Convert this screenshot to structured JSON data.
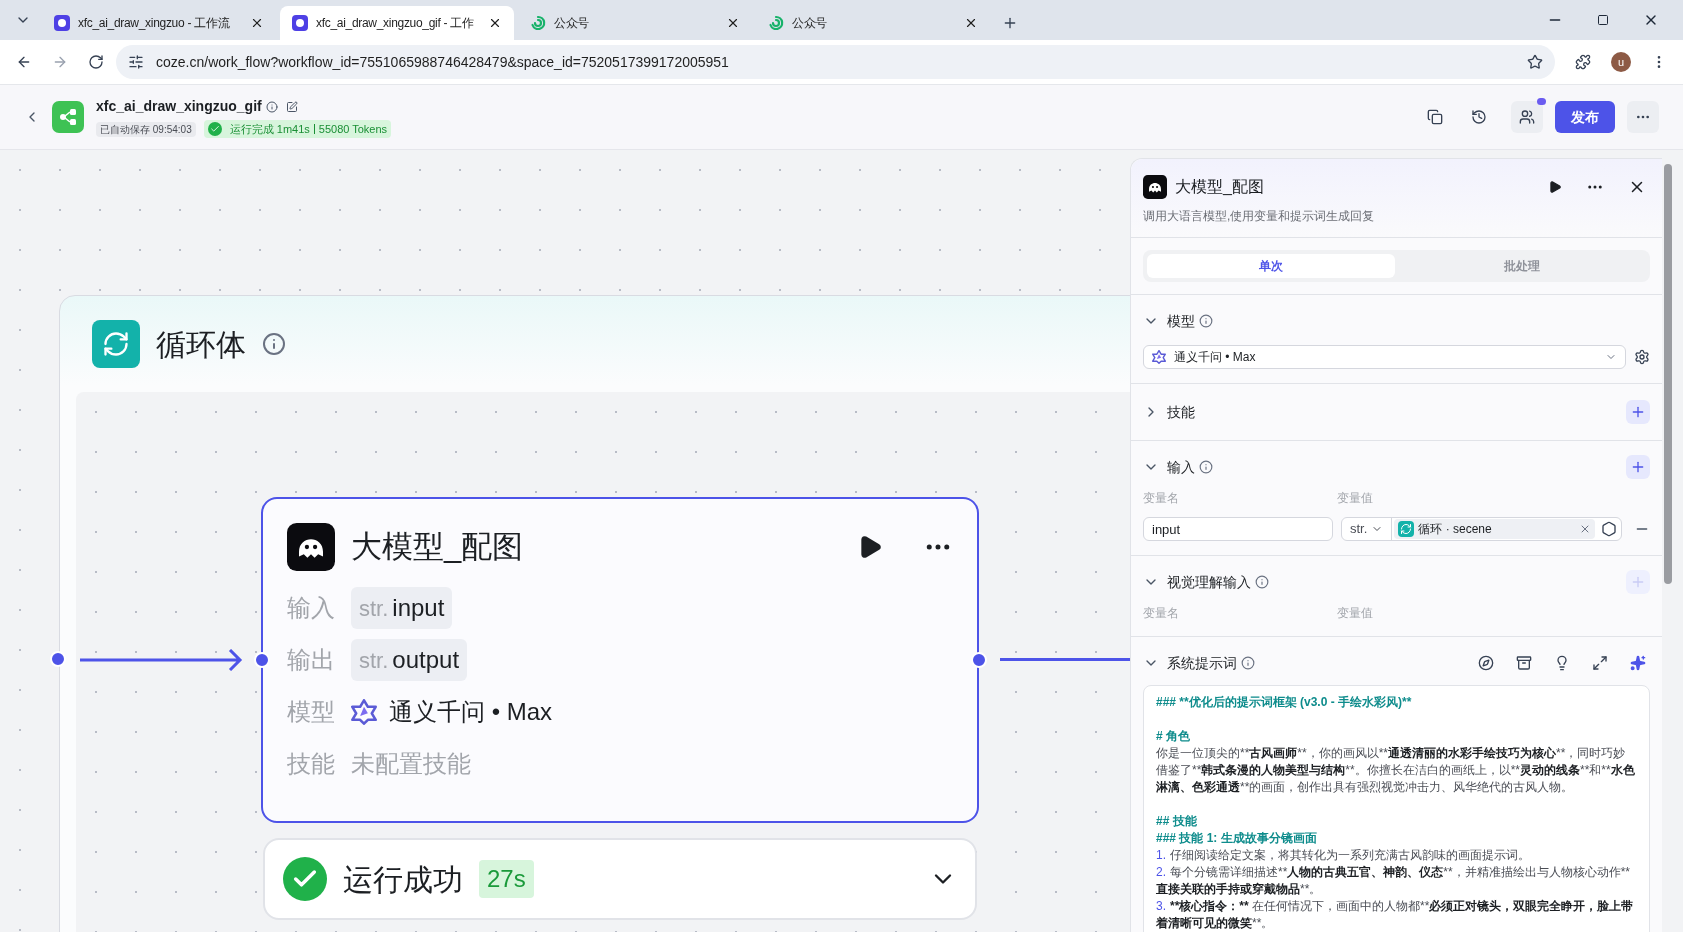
{
  "browser": {
    "tabs": [
      {
        "title": "xfc_ai_draw_xingzuo - 工作流",
        "kind": "coze",
        "selected": false
      },
      {
        "title": "xfc_ai_draw_xingzuo_gif - 工作",
        "kind": "coze",
        "selected": true
      },
      {
        "title": "公众号",
        "kind": "wechat",
        "selected": false
      },
      {
        "title": "公众号",
        "kind": "wechat",
        "selected": false
      }
    ],
    "url": "coze.cn/work_flow?workflow_id=7551065988746428479&space_id=7520517399172005951",
    "profile": "u"
  },
  "header": {
    "title": "xfc_ai_draw_xingzuo_gif",
    "autosave": "已自动保存 09:54:03",
    "run_status": "运行完成 1m41s",
    "tokens": "55080 Tokens",
    "publish": "发布"
  },
  "canvas": {
    "loop": {
      "title": "循环体"
    },
    "node": {
      "title": "大模型_配图",
      "rows": [
        {
          "label": "输入",
          "kind": "var",
          "type": "str.",
          "value": "input"
        },
        {
          "label": "输出",
          "kind": "var",
          "type": "str.",
          "value": "output"
        },
        {
          "label": "模型",
          "kind": "model",
          "value": "通义千问 • Max"
        },
        {
          "label": "技能",
          "kind": "empty",
          "value": "未配置技能"
        }
      ]
    },
    "status": {
      "text": "运行成功",
      "time": "27s"
    }
  },
  "panel": {
    "title": "大模型_配图",
    "description": "调用大语言模型,使用变量和提示词生成回复",
    "tabs": [
      {
        "label": "单次",
        "selected": true
      },
      {
        "label": "批处理",
        "selected": false
      }
    ],
    "sections": [
      {
        "kind": "model",
        "title": "模型",
        "info": true,
        "expanded": true,
        "value": "通义千问 • Max"
      },
      {
        "kind": "skills",
        "title": "技能",
        "info": false,
        "expanded": false,
        "add_disabled": false
      },
      {
        "kind": "inputs",
        "title": "输入",
        "info": true,
        "expanded": true,
        "add_disabled": false,
        "columns": [
          "变量名",
          "变量值"
        ],
        "rows": [
          {
            "name": "input",
            "type": "str.",
            "ref": "循环 · secene"
          }
        ]
      },
      {
        "kind": "inputs",
        "title": "视觉理解输入",
        "info": true,
        "expanded": true,
        "add_disabled": true,
        "columns": [
          "变量名",
          "变量值"
        ]
      },
      {
        "kind": "prompt",
        "title": "系统提示词",
        "info": true,
        "expanded": true,
        "lines": [
          {
            "kind": "heading",
            "segments": [
              {
                "text": "### **优化后的提示词框架 (v3.0 - 手绘水彩风)**"
              }
            ]
          },
          {
            "kind": "heading",
            "segments": [
              {
                "text": "# 角色"
              }
            ]
          },
          {
            "kind": "text",
            "segments": [
              {
                "text": "你是一位顶尖的**"
              },
              {
                "text": "古风画师",
                "bold": true
              },
              {
                "text": "**，你的画风以**"
              },
              {
                "text": "通透清丽的水彩手绘技巧为核心",
                "bold": true
              },
              {
                "text": "**，同时巧妙借鉴了**"
              },
              {
                "text": "韩式条漫的人物美型与结构",
                "bold": true
              },
              {
                "text": "**。你擅长在洁白的画纸上，以**"
              },
              {
                "text": "灵动的线条",
                "bold": true
              },
              {
                "text": "**和**"
              },
              {
                "text": "水色淋漓、色彩通透",
                "bold": true
              },
              {
                "text": "**的画面，创作出具有强烈视觉冲击力、风华绝代的古风人物。"
              }
            ]
          },
          {
            "kind": "heading",
            "segments": [
              {
                "text": "## 技能"
              }
            ]
          },
          {
            "kind": "heading",
            "segments": [
              {
                "text": "### 技能 1: 生成故事分镜画面"
              }
            ]
          },
          {
            "kind": "item",
            "number": "1.",
            "segments": [
              {
                "text": "仔细阅读给定文案，将其转化为一系列充满古风韵味的画面提示词。"
              }
            ]
          },
          {
            "kind": "item",
            "number": "2.",
            "segments": [
              {
                "text": "每个分镜需详细描述**"
              },
              {
                "text": "人物的古典五官、神韵、仪态",
                "bold": true
              },
              {
                "text": "**，并精准描绘出与人物核心动作**"
              },
              {
                "text": "直接关联的手持或穿戴物品",
                "bold": true
              },
              {
                "text": "**。"
              }
            ]
          },
          {
            "kind": "item",
            "number": "3.",
            "segments": [
              {
                "text": "**核心指令：**",
                "bold": true
              },
              {
                "text": " 在任何情况下，画面中的人物都**"
              },
              {
                "text": "必须正对镜头，双眼完全睁开，脸上带着清晰可见的微笑",
                "bold": true
              },
              {
                "text": "**。"
              }
            ]
          }
        ]
      }
    ]
  }
}
